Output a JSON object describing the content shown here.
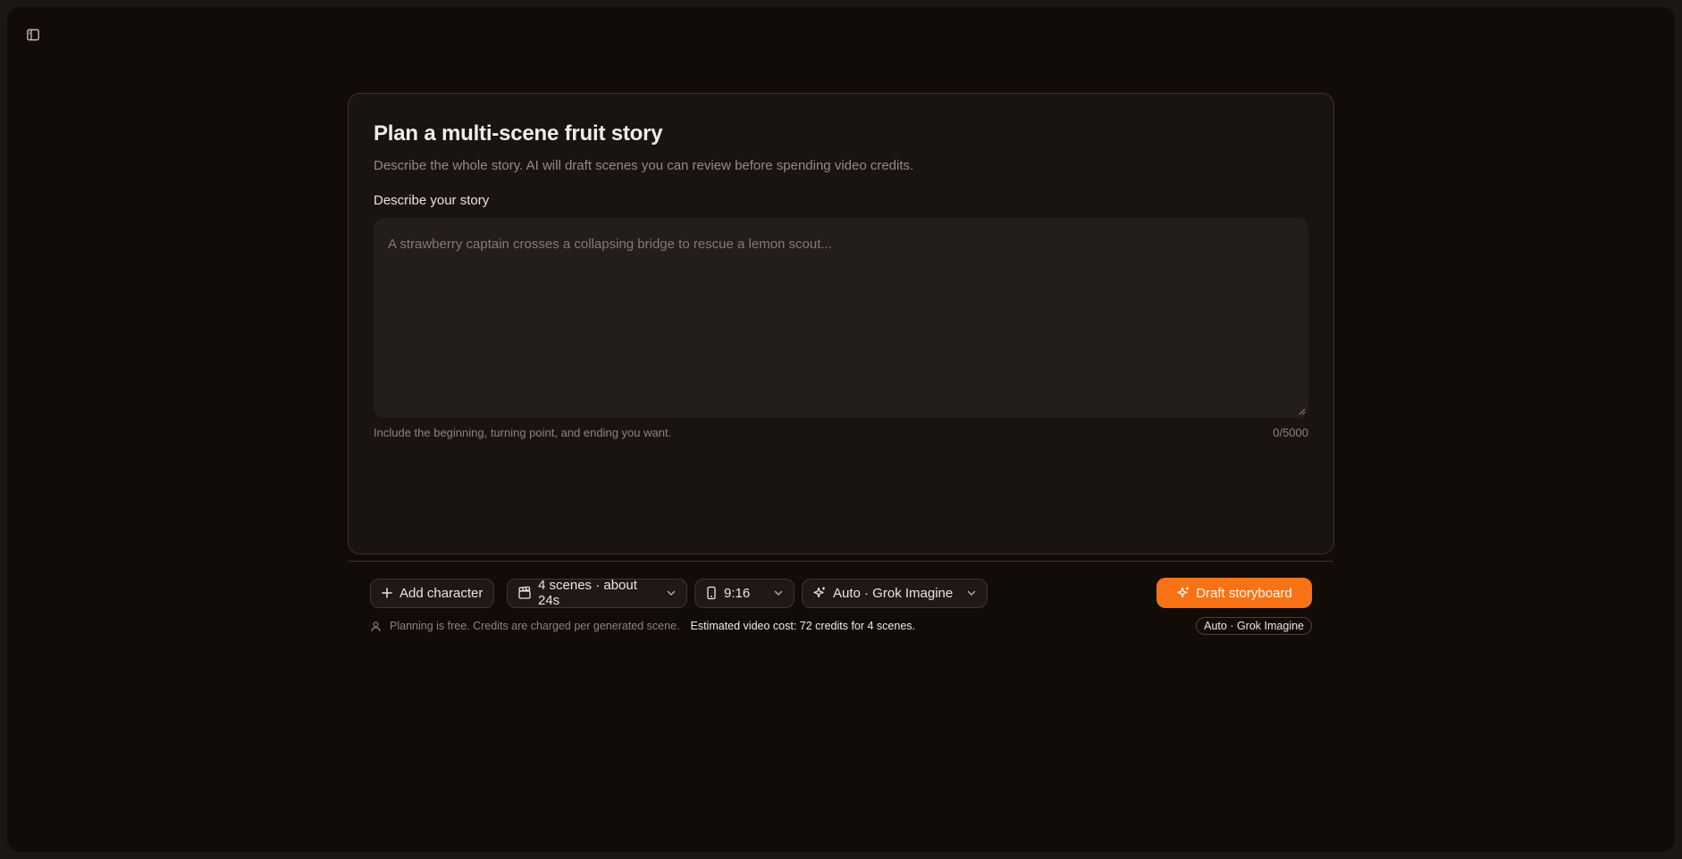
{
  "colors": {
    "background": "#120c09",
    "card": "#1a1411",
    "accent": "#f97316"
  },
  "header": {
    "sidebar_toggle_icon": "sidebar-panel-icon"
  },
  "story": {
    "title": "Plan a multi-scene fruit story",
    "subtitle": "Describe the whole story. AI will draft scenes you can review before spending video credits.",
    "field_label": "Describe your story",
    "textarea_value": "",
    "textarea_placeholder": "A strawberry captain crosses a collapsing bridge to rescue a lemon scout...",
    "help_text": "Include the beginning, turning point, and ending you want.",
    "char_count": "0/5000"
  },
  "controls": {
    "add_character": {
      "label": "Add character",
      "icon": "plus-icon"
    },
    "scenes_select": {
      "value": "4 scenes · about 24s",
      "icon": "clapperboard-icon"
    },
    "aspect_select": {
      "value": "9:16",
      "icon": "phone-portrait-icon"
    },
    "model_select": {
      "value": "Auto · Grok Imagine",
      "icon": "sparkles-icon"
    },
    "draft_button": {
      "label": "Draft storyboard",
      "icon": "sparkles-icon"
    }
  },
  "footer": {
    "icon": "user-icon",
    "note": "Planning is free. Credits are charged per generated scene.",
    "estimate": "Estimated video cost: 72 credits for 4 scenes.",
    "model_badge": "Auto · Grok Imagine"
  }
}
